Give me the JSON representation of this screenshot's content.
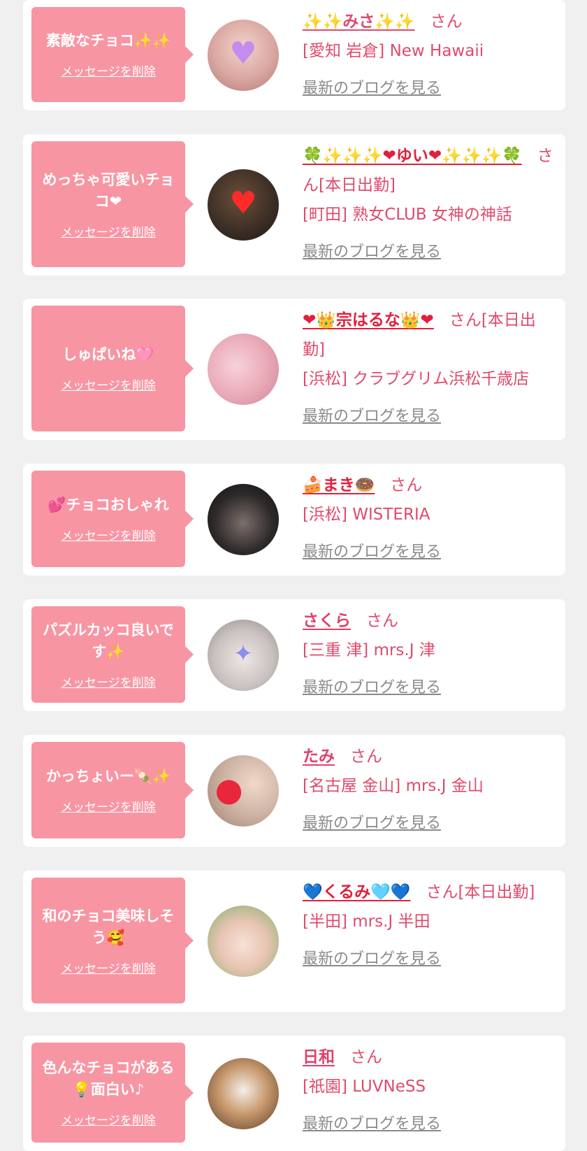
{
  "entries": [
    {
      "message": "素敵なチョコ✨✨",
      "delete_label": "メッセージを削除",
      "name": "✨✨みさ✨✨",
      "san": "さん",
      "shop": "[愛知 岩倉] New Hawaii",
      "blog_label": "最新のブログを見る"
    },
    {
      "message": "めっちゃ可愛いチョコ❤",
      "delete_label": "メッセージを削除",
      "name": "🍀✨✨✨❤ゆい❤✨✨✨🍀",
      "san": "さん[本日出勤]",
      "shop": "[町田] 熟女CLUB 女神の神話",
      "blog_label": "最新のブログを見る"
    },
    {
      "message": "しゅぱいね🩷",
      "delete_label": "メッセージを削除",
      "name": "❤👑宗はるな👑❤",
      "san": "さん[本日出勤]",
      "shop": "[浜松] クラブグリム浜松千歳店",
      "blog_label": "最新のブログを見る"
    },
    {
      "message": "💕チョコおしゃれ",
      "delete_label": "メッセージを削除",
      "name": "🍰まき🍩",
      "san": "さん",
      "shop": "[浜松] WISTERIA",
      "blog_label": "最新のブログを見る"
    },
    {
      "message": "パズルカッコ良いです✨",
      "delete_label": "メッセージを削除",
      "name": "さくら",
      "san": "さん",
      "shop": "[三重 津] mrs.J 津",
      "blog_label": "最新のブログを見る"
    },
    {
      "message": "かっちょいー🍡✨",
      "delete_label": "メッセージを削除",
      "name": "たみ",
      "san": "さん",
      "shop": "[名古屋 金山] mrs.J 金山",
      "blog_label": "最新のブログを見る"
    },
    {
      "message": "和のチョコ美味しそう🥰",
      "delete_label": "メッセージを削除",
      "name": "💙くるみ🩵💙",
      "san": "さん[本日出勤]",
      "shop": "[半田] mrs.J 半田",
      "blog_label": "最新のブログを見る"
    },
    {
      "message": "色んなチョコがある💡面白い♪",
      "delete_label": "メッセージを削除",
      "name": "日和",
      "san": "さん",
      "shop": "[祇園] LUVNeSS",
      "blog_label": "最新のブログを見る"
    }
  ],
  "colors": {
    "page_bg": "#f0f0f0",
    "bubble": "#f895a3",
    "text_pink": "#e04a6c",
    "link_gray": "#8a8a8a"
  }
}
